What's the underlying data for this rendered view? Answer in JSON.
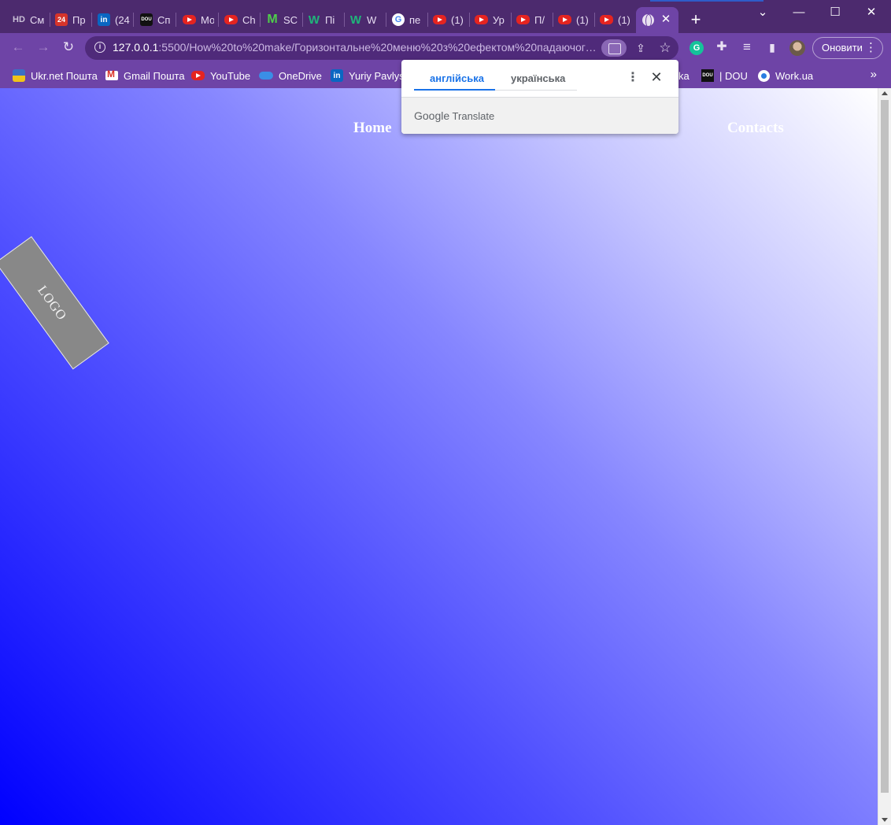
{
  "browser": {
    "tabs": [
      {
        "icon": "hd-icon",
        "badge": "HD",
        "label": "См"
      },
      {
        "icon": "24-icon",
        "badge": "24",
        "label": "Пр"
      },
      {
        "icon": "linkedin-icon",
        "badge": "in",
        "label": "(24"
      },
      {
        "icon": "dou-icon",
        "badge": "DOU",
        "label": "Сп"
      },
      {
        "icon": "youtube-icon",
        "badge": "",
        "label": "Мо"
      },
      {
        "icon": "youtube-icon",
        "badge": "",
        "label": "Ch"
      },
      {
        "icon": "m-icon",
        "badge": "M",
        "label": "SC"
      },
      {
        "icon": "w-icon",
        "badge": "W",
        "label": "Пі"
      },
      {
        "icon": "w-icon",
        "badge": "W",
        "label": "W"
      },
      {
        "icon": "google-icon",
        "badge": "G",
        "label": "пе"
      },
      {
        "icon": "youtube-icon",
        "badge": "",
        "label": "(1)"
      },
      {
        "icon": "youtube-icon",
        "badge": "",
        "label": "Ур"
      },
      {
        "icon": "youtube-icon",
        "badge": "",
        "label": "П/"
      },
      {
        "icon": "youtube-icon",
        "badge": "",
        "label": "(1)"
      },
      {
        "icon": "youtube-icon",
        "badge": "",
        "label": "(1)"
      }
    ],
    "active_tab": {
      "icon": "globe-icon",
      "close": "✕"
    },
    "new_tab": "+",
    "window": {
      "dropdown": "⌄",
      "minimize": "—",
      "maximize": "☐",
      "close": "✕"
    },
    "toolbar": {
      "back": "←",
      "forward": "→",
      "reload": "↻",
      "info": "i",
      "url_host": "127.0.0.1",
      "url_rest": ":5500/How%20to%20make/Горизонтальне%20меню%20з%20ефектом%20падаючого...",
      "share": "⇪",
      "star": "☆",
      "grammarly": "G",
      "extensions": "✚",
      "media": "≡",
      "sidepanel": "▮",
      "update_label": "Оновити",
      "menu": "⋮"
    },
    "bookmarks": [
      {
        "icon": "ukrnet-icon",
        "label": "Ukr.net Пошта"
      },
      {
        "icon": "gmail-icon",
        "label": "Gmail Пошта"
      },
      {
        "icon": "youtube-icon",
        "label": "YouTube"
      },
      {
        "icon": "onedrive-icon",
        "label": "OneDrive"
      },
      {
        "icon": "linkedin-icon",
        "label": "Yuriy Pavlysh"
      },
      {
        "icon": "",
        "label": "ka"
      },
      {
        "icon": "dou-icon",
        "label": "| DOU"
      },
      {
        "icon": "workua-icon",
        "label": "Work.ua"
      }
    ],
    "bookmarks_more": "»"
  },
  "translate_popup": {
    "tab_english": "англійська",
    "tab_ukrainian": "українська",
    "menu": "⋮",
    "close": "✕",
    "brand_google": "Google",
    "brand_translate": "Translate"
  },
  "page": {
    "logo": "LOGO",
    "nav": {
      "home": "Home",
      "contacts": "Contacts"
    },
    "background_colors": {
      "start": "#0000ff",
      "end": "#ffffff"
    }
  }
}
